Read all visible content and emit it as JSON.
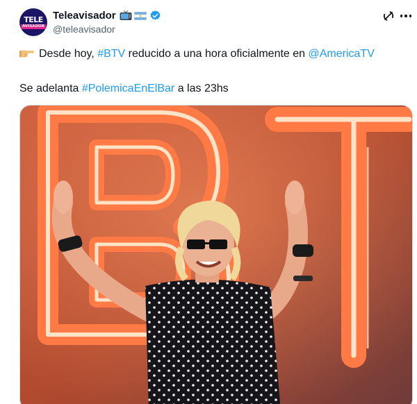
{
  "author": {
    "display_name": "Teleavisador",
    "handle": "@teleavisador",
    "avatar_text_top": "TELE",
    "avatar_text_bottom": "AVISADOR",
    "name_emojis": [
      "tv-icon",
      "argentina-flag-icon"
    ],
    "verified": true
  },
  "tweet": {
    "line1": {
      "pointer_emoji": "backhand-index-pointing-right-icon",
      "text_before": "Desde hoy, ",
      "hashtag": "#BTV",
      "text_middle": " reducido a una hora oficialmente en ",
      "mention": "@AmericaTV"
    },
    "line2": {
      "text_before": "Se adelanta ",
      "hashtag": "#PolemicaEnElBar",
      "text_after": " a las 23hs"
    }
  },
  "actions": {
    "grok_icon": "grok-icon",
    "more_icon": "more-horizontal-icon"
  },
  "media": {
    "description_icon": "photo",
    "sign_letters": "BT"
  },
  "colors": {
    "link": "#1d9bf0",
    "verified": "#1d9bf0",
    "handle": "#536471",
    "neon": "#ff5a2a",
    "avatar_bg": "#1c1464",
    "avatar_accent": "#e0218a"
  }
}
